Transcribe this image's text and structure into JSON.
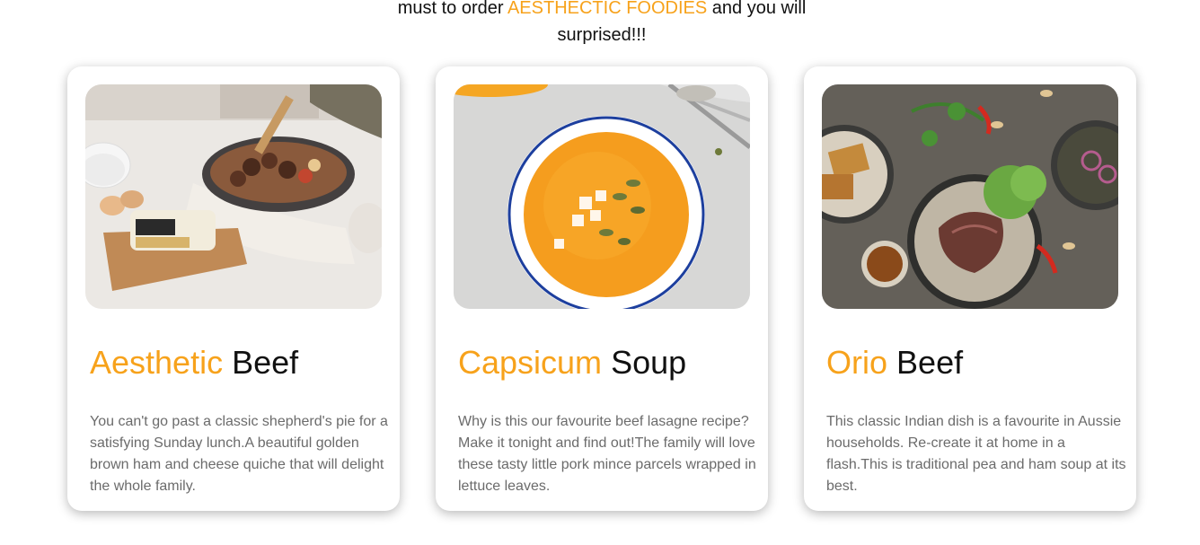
{
  "intro": {
    "prefix": "must to order",
    "brand": "AESTHECTIC FOODIES",
    "suffix": "and you will",
    "line2": "surprised!!!"
  },
  "colors": {
    "accent": "#f7a21b",
    "text": "#111111",
    "muted": "#6b6b6b"
  },
  "cards": [
    {
      "title_accent": "Aesthetic",
      "title_rest": "Beef",
      "description": "You can't go past a classic shepherd's pie for a satisfying Sunday lunch.A beautiful golden brown ham and cheese quiche that will delight the whole family.",
      "image": "skillet-sausage-photo"
    },
    {
      "title_accent": "Capsicum",
      "title_rest": "Soup",
      "description": "Why is this our favourite beef lasagne recipe? Make it tonight and find out!The family will love these tasty little pork mince parcels wrapped in lettuce leaves.",
      "image": "pumpkin-soup-photo"
    },
    {
      "title_accent": "Orio",
      "title_rest": "Beef",
      "description": "This classic Indian dish is a favourite in Aussie households. Re-create it at home in a flash.This is traditional pea and ham soup at its best.",
      "image": "beef-salad-photo"
    }
  ]
}
